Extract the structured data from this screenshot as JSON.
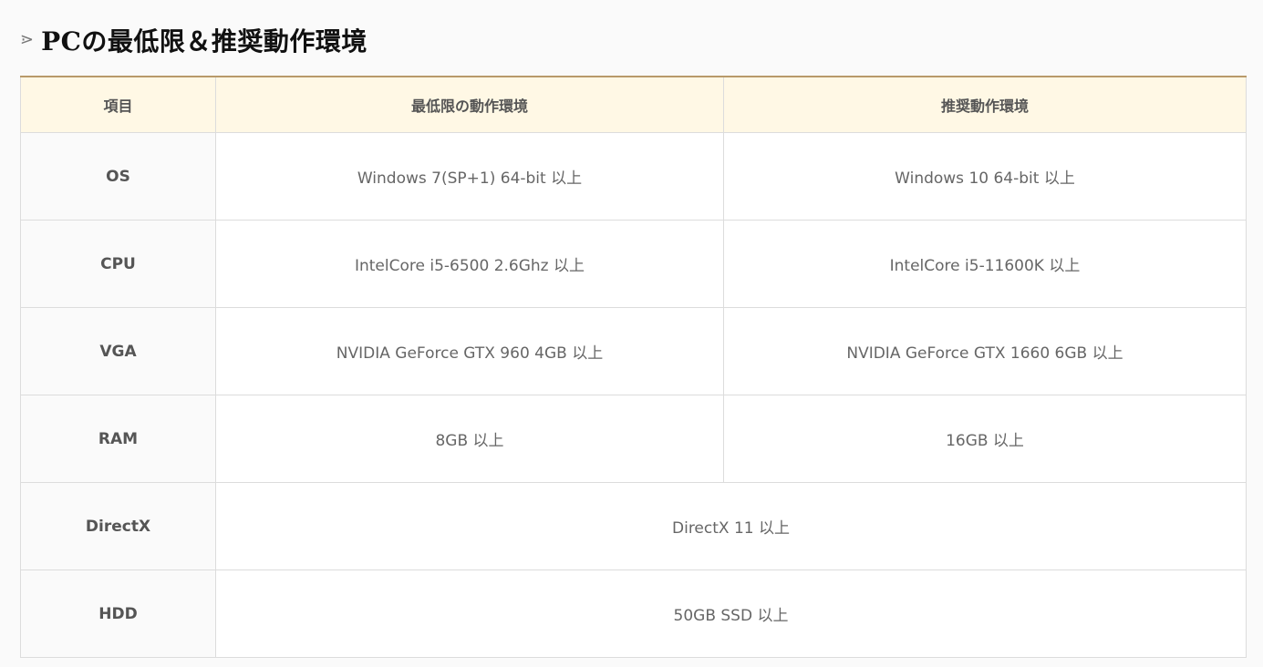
{
  "heading": {
    "icon": "chevron-right-icon",
    "title": "PCの最低限＆推奨動作環境"
  },
  "table": {
    "headers": [
      "項目",
      "最低限の動作環境",
      "推奨動作環境"
    ],
    "rows": [
      {
        "label": "OS",
        "min": "Windows 7(SP+1) 64-bit 以上",
        "rec": "Windows 10 64-bit 以上"
      },
      {
        "label": "CPU",
        "min": "IntelCore i5-6500 2.6Ghz 以上",
        "rec": "IntelCore i5-11600K 以上"
      },
      {
        "label": "VGA",
        "min": "NVIDIA GeForce GTX 960 4GB 以上",
        "rec": "NVIDIA GeForce GTX 1660 6GB 以上"
      },
      {
        "label": "RAM",
        "min": "8GB 以上",
        "rec": "16GB 以上"
      },
      {
        "label": "DirectX",
        "both": "DirectX 11 以上"
      },
      {
        "label": "HDD",
        "both": "50GB SSD 以上"
      }
    ]
  },
  "colors": {
    "header_bg": "#fff8e5",
    "top_border": "#b89a6a",
    "grid": "#dcdcdc"
  }
}
